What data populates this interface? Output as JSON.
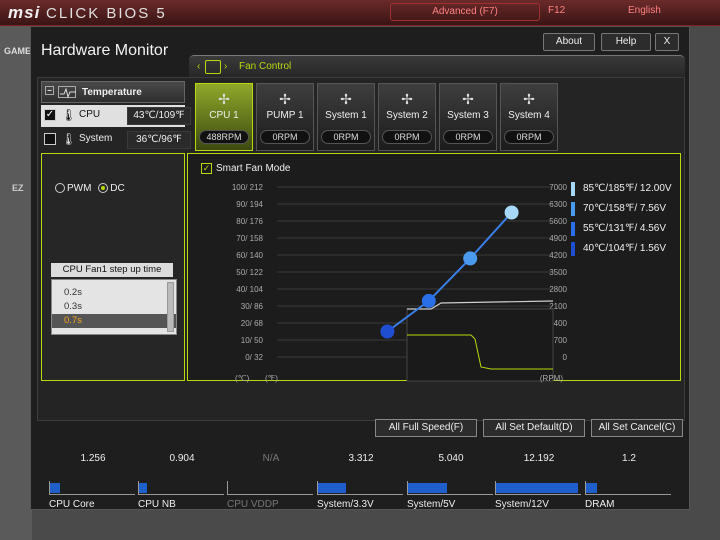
{
  "bios": {
    "brand": "msi",
    "product": "CLICK BIOS 5",
    "mode_button": "Advanced (F7)",
    "f12": "F12",
    "language": "English",
    "side_label": "GAME",
    "ez_label": "EZ"
  },
  "dialog": {
    "title": "Hardware Monitor",
    "about": "About",
    "help": "Help",
    "close": "X",
    "fan_control_label": "Fan Control"
  },
  "temperature": {
    "header": "Temperature",
    "rows": [
      {
        "name": "CPU",
        "value": "43℃/109℉",
        "checked": true
      },
      {
        "name": "System",
        "value": "36℃/96℉",
        "checked": false
      }
    ]
  },
  "fans": [
    {
      "name": "CPU 1",
      "rpm": "488RPM",
      "active": true
    },
    {
      "name": "PUMP 1",
      "rpm": "0RPM",
      "active": false
    },
    {
      "name": "System 1",
      "rpm": "0RPM",
      "active": false
    },
    {
      "name": "System 2",
      "rpm": "0RPM",
      "active": false
    },
    {
      "name": "System 3",
      "rpm": "0RPM",
      "active": false
    },
    {
      "name": "System 4",
      "rpm": "0RPM",
      "active": false
    }
  ],
  "mode": {
    "pwm": "PWM",
    "dc": "DC",
    "selected": "DC"
  },
  "stepup": {
    "label": "CPU Fan1 step up time",
    "options": [
      "0.2s",
      "0.3s",
      "0.7s"
    ],
    "selected": "0.7s"
  },
  "smart_fan": {
    "label": "Smart Fan Mode",
    "checked": true
  },
  "chart_data": {
    "type": "line",
    "left_ticks": [
      "100/ 212",
      "90/ 194",
      "80/ 176",
      "70/ 158",
      "60/ 140",
      "50/ 122",
      "40/ 104",
      "30/  86",
      "20/  68",
      "10/  50",
      "0/  32"
    ],
    "right_ticks": [
      "7000",
      "6300",
      "5600",
      "4900",
      "4200",
      "3500",
      "2800",
      "2100",
      "1400",
      "700",
      "0"
    ],
    "left_unit": "(℃)",
    "left_unit2": "(℉)",
    "right_unit": "(RPM)",
    "curve_points": [
      {
        "temp_c": 40,
        "percent": 15,
        "color": "#1f4fd0"
      },
      {
        "temp_c": 55,
        "percent": 33,
        "color": "#2a6fe8"
      },
      {
        "temp_c": 70,
        "percent": 58,
        "color": "#4a9bf0"
      },
      {
        "temp_c": 85,
        "percent": 85,
        "color": "#a8d8f8"
      }
    ]
  },
  "legend": [
    {
      "temp": "85℃/185℉/",
      "volt": "12.00V",
      "color": "#a8d8f8"
    },
    {
      "temp": "70℃/158℉/",
      "volt": "7.56V",
      "color": "#4a9bf0"
    },
    {
      "temp": "55℃/131℉/",
      "volt": "4.56V",
      "color": "#2a6fe8"
    },
    {
      "temp": "40℃/104℉/",
      "volt": "1.56V",
      "color": "#1f4fd0"
    }
  ],
  "actions": {
    "full_speed": "All Full Speed(F)",
    "set_default": "All Set Default(D)",
    "set_cancel": "All Set Cancel(C)"
  },
  "voltages": [
    {
      "name": "CPU Core",
      "value": "1.256",
      "fill": 0.12,
      "dim": false
    },
    {
      "name": "CPU NB",
      "value": "0.904",
      "fill": 0.09,
      "dim": false
    },
    {
      "name": "CPU VDDP",
      "value": "N/A",
      "fill": 0.0,
      "dim": true
    },
    {
      "name": "System/3.3V",
      "value": "3.312",
      "fill": 0.33,
      "dim": false
    },
    {
      "name": "System/5V",
      "value": "5.040",
      "fill": 0.45,
      "dim": false
    },
    {
      "name": "System/12V",
      "value": "12.192",
      "fill": 0.95,
      "dim": false
    },
    {
      "name": "DRAM",
      "value": "1.2",
      "fill": 0.13,
      "dim": false
    }
  ]
}
